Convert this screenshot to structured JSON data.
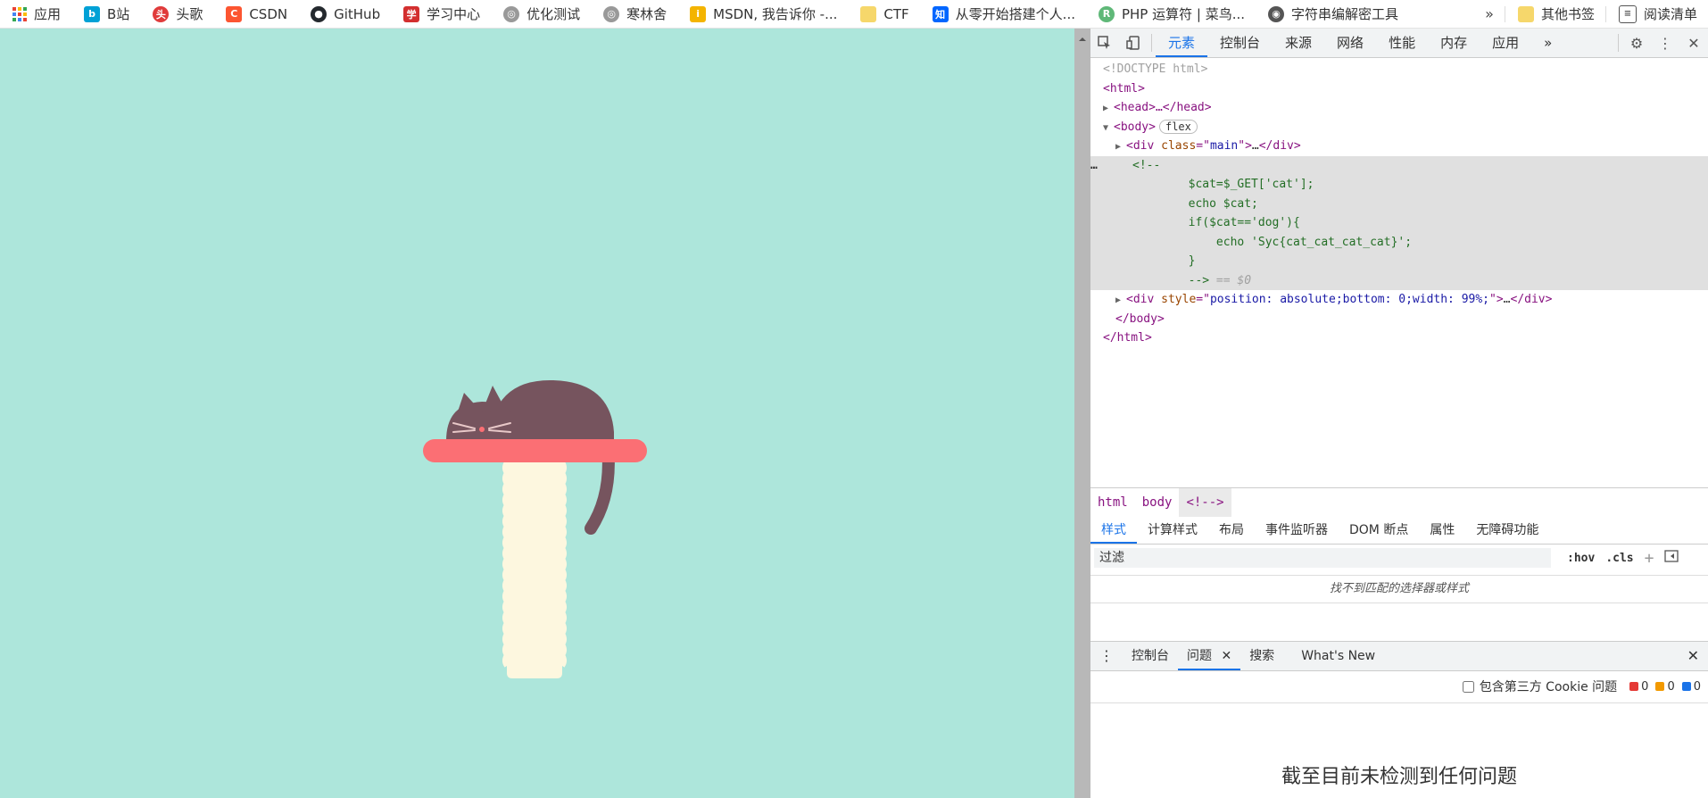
{
  "bookmarks": {
    "items": [
      {
        "label": "应用",
        "icon": "apps-grid-icon",
        "color": "#e94235"
      },
      {
        "label": "B站",
        "icon": "bilibili-icon",
        "color": "#00a1d6"
      },
      {
        "label": "头歌",
        "icon": "touge-icon",
        "color": "#e03b3b"
      },
      {
        "label": "CSDN",
        "icon": "csdn-icon",
        "color": "#fc5531"
      },
      {
        "label": "GitHub",
        "icon": "github-icon",
        "color": "#24292e"
      },
      {
        "label": "学习中心",
        "icon": "study-center-icon",
        "color": "#d32f2f"
      },
      {
        "label": "优化测试",
        "icon": "globe-icon",
        "color": "#888888"
      },
      {
        "label": "寒林舍",
        "icon": "globe-icon",
        "color": "#888888"
      },
      {
        "label": "MSDN, 我告诉你 -...",
        "icon": "msdn-icon",
        "color": "#f4b400"
      },
      {
        "label": "CTF",
        "icon": "folder-icon",
        "color": "#f6d76b"
      },
      {
        "label": "从零开始搭建个人...",
        "icon": "zhihu-icon",
        "color": "#0066ff"
      },
      {
        "label": "PHP 运算符 | 菜鸟...",
        "icon": "runoob-icon",
        "color": "#5fb878"
      },
      {
        "label": "字符串编解密工具",
        "icon": "globe-icon",
        "color": "#555555"
      }
    ],
    "more": "»",
    "other_label": "其他书签",
    "reading_label": "阅读清单"
  },
  "devtools": {
    "tabs": [
      "元素",
      "控制台",
      "来源",
      "网络",
      "性能",
      "内存",
      "应用"
    ],
    "active_tab": "元素",
    "more_tabs": "»",
    "dom": {
      "doctype": "<!DOCTYPE html>",
      "html_open": "<html>",
      "head": "<head>…</head>",
      "body_open": "<body>",
      "flex_badge": "flex",
      "div_main_class": "main",
      "comment_lines": [
        "<!--",
        "        $cat=$_GET['cat'];",
        "        echo $cat;",
        "        if($cat=='dog'){",
        "            echo 'Syc{cat_cat_cat_cat}';",
        "        }",
        "        -->"
      ],
      "comment_marker": "== $0",
      "div_style": "position: absolute;bottom: 0;width: 99%;",
      "body_close": "</body>",
      "html_close": "</html>"
    },
    "breadcrumbs": [
      "html",
      "body",
      "<!-->"
    ],
    "style_tabs": [
      "样式",
      "计算样式",
      "布局",
      "事件监听器",
      "DOM 断点",
      "属性",
      "无障碍功能"
    ],
    "filter_placeholder": "过滤",
    "hov": ":hov",
    "cls": ".cls",
    "no_match": "找不到匹配的选择器或样式",
    "drawer_tabs": [
      "控制台",
      "问题",
      "搜索",
      "What's New"
    ],
    "third_party": "包含第三方 Cookie 问题",
    "counts": {
      "errors": "0",
      "warnings": "0",
      "info": "0"
    },
    "no_issues": "截至目前未检测到任何问题"
  },
  "colors": {
    "page_bg": "#ade6db",
    "cat": "#76545e",
    "shelf": "#fb6f74",
    "post": "#fdf7df",
    "accent": "#1a73e8"
  }
}
